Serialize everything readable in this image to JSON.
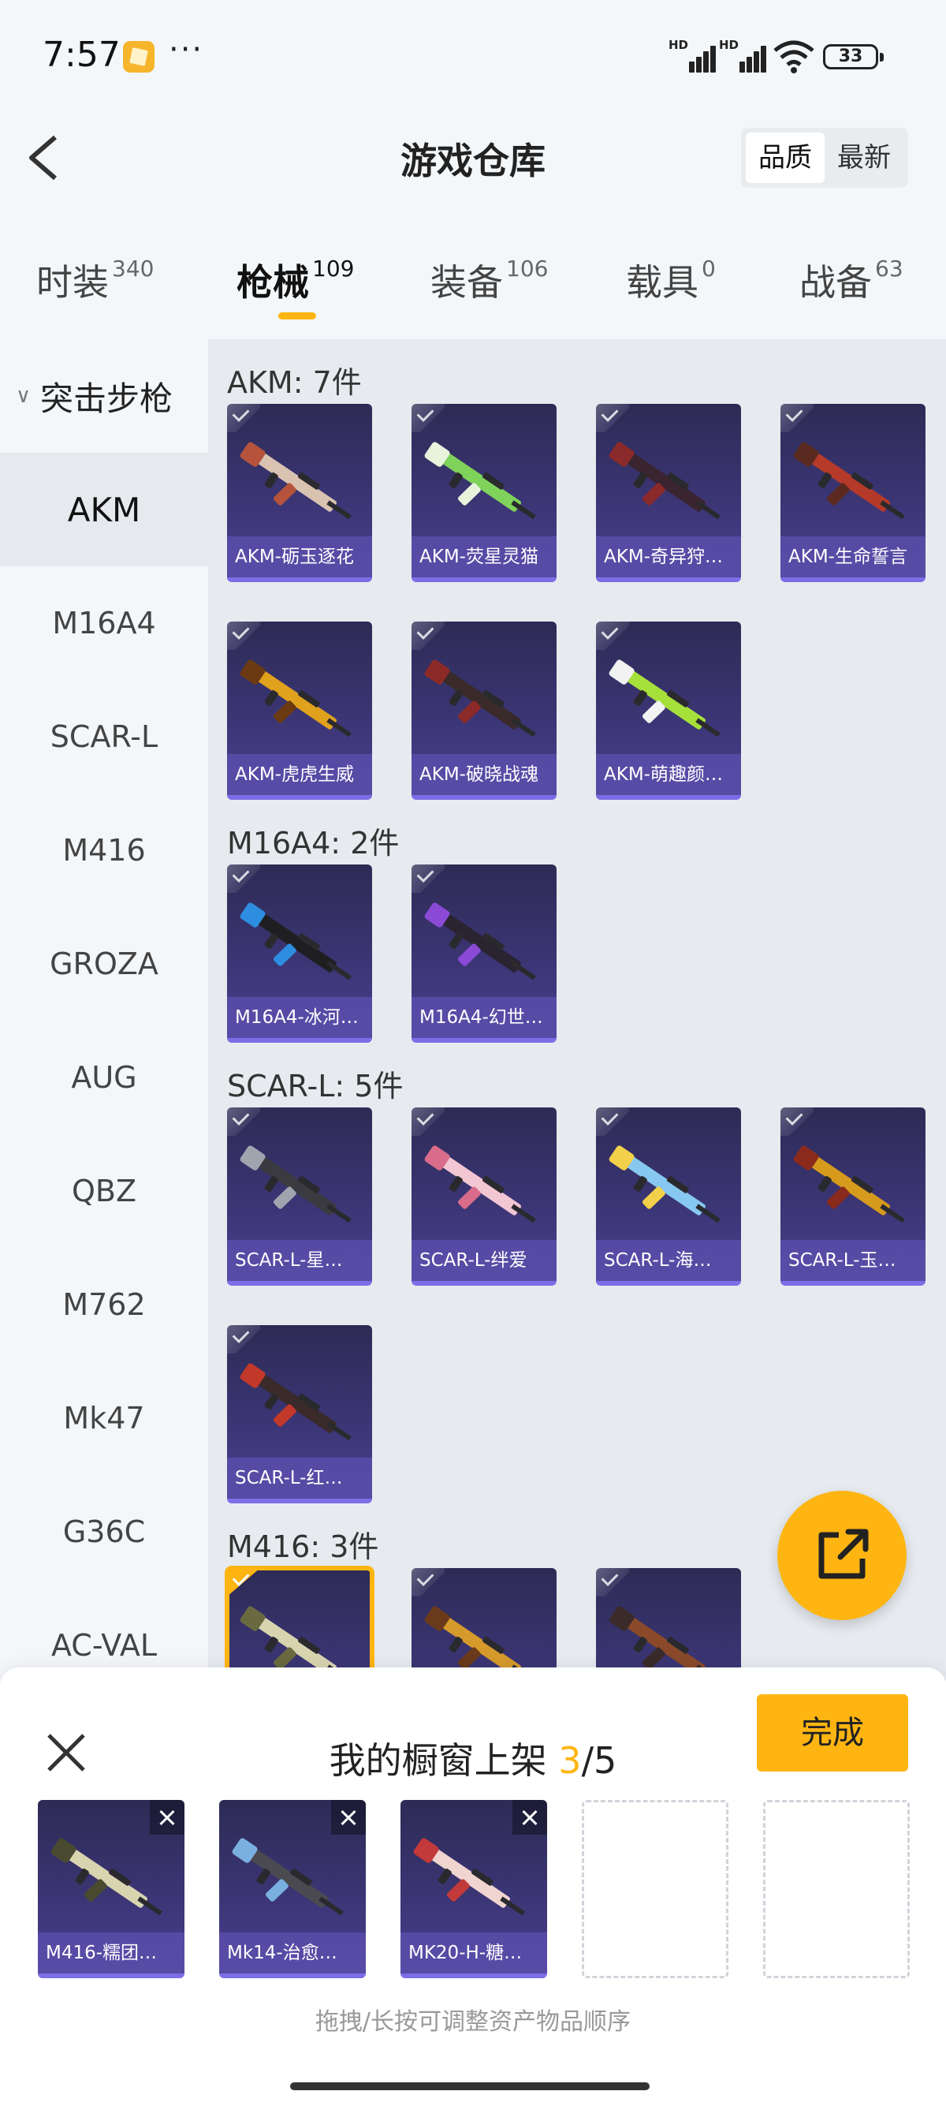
{
  "status_bar": {
    "time": "7:57",
    "more": "···",
    "battery": "33",
    "hd1": "HD",
    "hd2": "HD"
  },
  "header": {
    "title": "游戏仓库",
    "sort_options": [
      "品质",
      "最新"
    ],
    "active_sort": "品质"
  },
  "tabs": [
    {
      "label": "时装",
      "count": "340"
    },
    {
      "label": "枪械",
      "count": "109"
    },
    {
      "label": "装备",
      "count": "106"
    },
    {
      "label": "载具",
      "count": "0"
    },
    {
      "label": "战备",
      "count": "63"
    }
  ],
  "sidebar": {
    "group": "突击步枪",
    "items": [
      "AKM",
      "M16A4",
      "SCAR-L",
      "M416",
      "GROZA",
      "AUG",
      "QBZ",
      "M762",
      "Mk47",
      "G36C",
      "AC-VAL"
    ],
    "active": "AKM"
  },
  "sections": [
    {
      "title": "AKM: 7件",
      "items": [
        {
          "label": "AKM-砺玉逐花",
          "body": "#d9c2b0",
          "accent": "#b5533c"
        },
        {
          "label": "AKM-荧星灵猫",
          "body": "#7fd25a",
          "accent": "#e8f3dc"
        },
        {
          "label": "AKM-奇异狩…",
          "body": "#3a2430",
          "accent": "#8a2a2a"
        },
        {
          "label": "AKM-生命誓言",
          "body": "#b53a2a",
          "accent": "#5a2a20"
        },
        {
          "label": "AKM-虎虎生威",
          "body": "#e0a11c",
          "accent": "#6b3a12"
        },
        {
          "label": "AKM-破晓战魂",
          "body": "#3a2a2a",
          "accent": "#8c2a28"
        },
        {
          "label": "AKM-萌趣颜…",
          "body": "#a6e03a",
          "accent": "#f2f2f2"
        }
      ]
    },
    {
      "title": "M16A4: 2件",
      "items": [
        {
          "label": "M16A4-冰河…",
          "body": "#1f1f22",
          "accent": "#2d8de0"
        },
        {
          "label": "M16A4-幻世…",
          "body": "#2a2330",
          "accent": "#8a4ad6"
        }
      ]
    },
    {
      "title": "SCAR-L: 5件",
      "items": [
        {
          "label": "SCAR-L-星…",
          "body": "#3a3a40",
          "accent": "#a0a4ae"
        },
        {
          "label": "SCAR-L-绊爱",
          "body": "#f2c6d3",
          "accent": "#d96c8a"
        },
        {
          "label": "SCAR-L-海…",
          "body": "#86c8f0",
          "accent": "#f2d04a"
        },
        {
          "label": "SCAR-L-玉…",
          "body": "#d69a1c",
          "accent": "#8a2a1c"
        },
        {
          "label": "SCAR-L-红…",
          "body": "#3a2a2a",
          "accent": "#c2382a"
        }
      ]
    },
    {
      "title": "M416: 3件",
      "items": [
        {
          "label": "",
          "body": "#d8d4b0",
          "accent": "#6a6a40",
          "selected": true
        },
        {
          "label": "",
          "body": "#d69a2c",
          "accent": "#6a3a1a"
        },
        {
          "label": "",
          "body": "#8a4a2a",
          "accent": "#3a2a2a"
        }
      ]
    }
  ],
  "showcase": {
    "title_prefix": "我的橱窗上架 ",
    "current": "3",
    "total": "/5",
    "done_label": "完成",
    "slots": [
      {
        "label": "M416-糯团…",
        "body": "#d8d4b0",
        "accent": "#4a4a30"
      },
      {
        "label": "Mk14-治愈…",
        "body": "#4a4a50",
        "accent": "#7ab0e0"
      },
      {
        "label": "MK20-H-糖…",
        "body": "#f0d4d0",
        "accent": "#c23a3a"
      }
    ],
    "empty_slots": 2,
    "hint": "拖拽/长按可调整资产物品顺序"
  },
  "colors": {
    "accent": "#ffb511",
    "card_bg": "#3b3574",
    "card_label": "#5a4eaa"
  }
}
